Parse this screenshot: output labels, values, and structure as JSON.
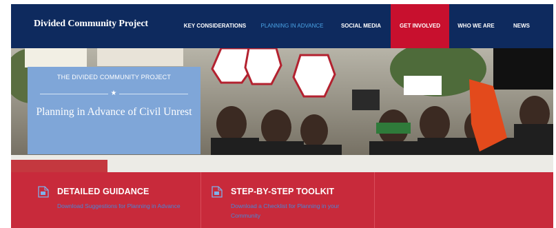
{
  "header": {
    "brand": "Divided Community Project",
    "nav": [
      {
        "label": "KEY CONSIDERATIONS",
        "state": "default"
      },
      {
        "label": "PLANNING IN ADVANCE",
        "state": "active"
      },
      {
        "label": "SOCIAL MEDIA",
        "state": "default"
      },
      {
        "label": "GET INVOLVED",
        "state": "cta"
      },
      {
        "label": "WHO WE ARE",
        "state": "default"
      },
      {
        "label": "NEWS",
        "state": "default"
      }
    ]
  },
  "hero": {
    "eyebrow": "THE DIVIDED COMMUNITY PROJECT",
    "title": "Planning in Advance of Civil Unrest",
    "image_description": "protest-crowd-photo"
  },
  "features": [
    {
      "title": "DETAILED GUIDANCE",
      "link": "Download Suggestions for Planning in Advance",
      "icon": "pdf-document-icon"
    },
    {
      "title": "STEP-BY-STEP TOOLKIT",
      "link": "Download a Checklist for Planning in your Community",
      "icon": "pdf-document-icon"
    }
  ],
  "colors": {
    "nav_bg": "#0e2a5e",
    "active_nav": "#4aa3e6",
    "cta_bg": "#c8102e",
    "card_bg": "#7fa6d8",
    "strip_bg": "#c82a3b",
    "link": "#4a86d6"
  }
}
